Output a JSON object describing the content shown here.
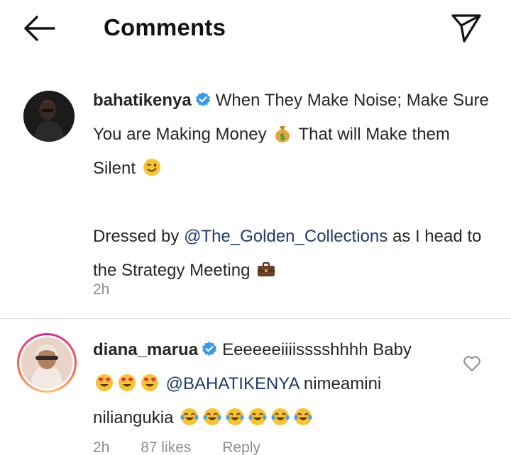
{
  "header": {
    "title": "Comments"
  },
  "caption": {
    "username": "bahatikenya",
    "text_1": "When They Make Noise; Make Sure You are Making Money",
    "text_2": "That will Make them Silent",
    "text_3": "Dressed by",
    "mention": "@The_Golden_Collections",
    "text_4": "as I head to the Strategy Meeting",
    "time": "2h"
  },
  "comment": {
    "username": "diana_marua",
    "text_1": "Eeeeeeiiiisssshhhh Baby",
    "mention": "@BAHATIKENYA",
    "text_2": "nimeamini niliangukia",
    "time": "2h",
    "likes": "87 likes",
    "reply_label": "Reply"
  },
  "icons": {
    "back": "arrow-left-icon",
    "send": "paper-plane-icon",
    "verified": "verified-badge-icon",
    "like": "heart-outline-icon"
  },
  "colors": {
    "verified": "#3897f0",
    "mention": "#1d3a6a",
    "secondary_text": "#8e8e8e"
  }
}
